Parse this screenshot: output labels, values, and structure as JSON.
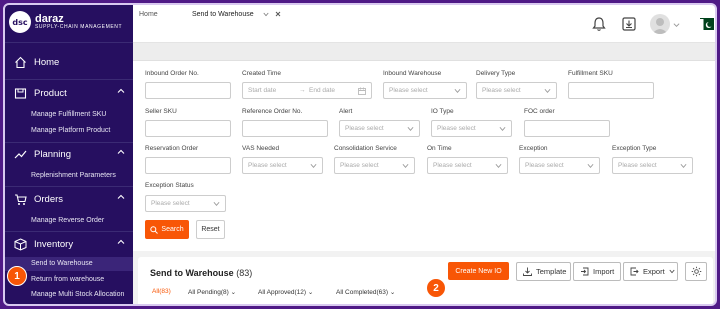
{
  "brand": {
    "mark": "dsc",
    "name": "daraz",
    "tagline": "SUPPLY-CHAIN MANAGEMENT"
  },
  "sidebar": {
    "home": "Home",
    "product": {
      "label": "Product",
      "items": [
        "Manage Fulfillment SKU",
        "Manage Platform Product"
      ]
    },
    "planning": {
      "label": "Planning",
      "items": [
        "Replenishment Parameters"
      ]
    },
    "orders": {
      "label": "Orders",
      "items": [
        "Manage Reverse Order"
      ]
    },
    "inventory": {
      "label": "Inventory",
      "items": [
        "Send to Warehouse",
        "Return from warehouse",
        "Manage Multi Stock Allocation"
      ]
    }
  },
  "tabs": {
    "home": "Home",
    "active": "Send to Warehouse"
  },
  "form": {
    "inbound_order_no": "Inbound Order No.",
    "created_time": "Created Time",
    "start_date": "Start date",
    "end_date": "End date",
    "inbound_warehouse": "Inbound Warehouse",
    "delivery_type": "Delivery Type",
    "fulfillment_sku": "Fulfillment SKU",
    "seller_sku": "Seller SKU",
    "reference_order_no": "Reference Order No.",
    "alert": "Alert",
    "io_type": "IO Type",
    "foc_order": "FOC order",
    "reservation_order": "Reservation Order",
    "vas_needed": "VAS Needed",
    "consolidation_service": "Consolidation Service",
    "on_time": "On Time",
    "exception": "Exception",
    "exception_type": "Exception Type",
    "exception_status": "Exception Status",
    "placeholder": "Please select",
    "search": "Search",
    "reset": "Reset"
  },
  "panel": {
    "title": "Send to Warehouse",
    "count": "(83)",
    "create": "Create New IO",
    "template": "Template",
    "import": "Import",
    "export": "Export",
    "filters": [
      "All(83)",
      "All Pending(8)",
      "All Approved(12)",
      "All Completed(63)"
    ]
  },
  "annotations": {
    "one": "1",
    "two": "2"
  },
  "colors": {
    "accent": "#f85606",
    "sidebar": "#260f60",
    "frame": "#4f1a86"
  }
}
